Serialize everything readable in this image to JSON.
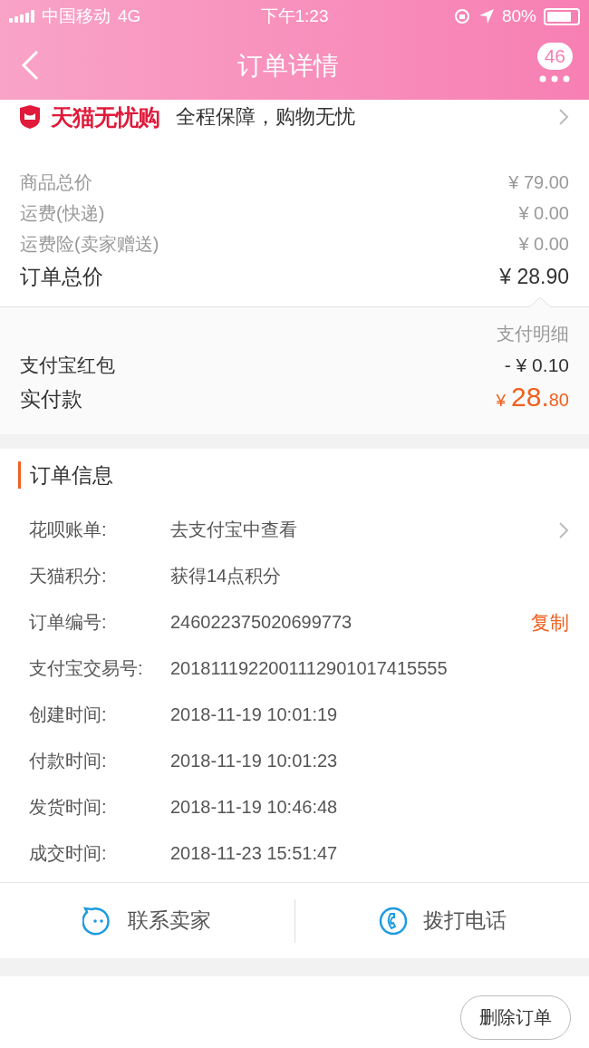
{
  "status_bar": {
    "carrier": "中国移动",
    "network": "4G",
    "time": "下午1:23",
    "battery": "80%"
  },
  "nav": {
    "title": "订单详情",
    "badge": "46"
  },
  "guarantee": {
    "brand": "天猫无忧购",
    "text": "全程保障，购物无忧"
  },
  "price_rows": [
    {
      "label": "商品总价",
      "value": "¥ 79.00"
    },
    {
      "label": "运费(快递)",
      "value": "¥ 0.00"
    },
    {
      "label": "运费险(卖家赠送)",
      "value": "¥ 0.00"
    }
  ],
  "total": {
    "label": "订单总价",
    "value": "¥ 28.90"
  },
  "payment": {
    "title": "支付明细",
    "rows": [
      {
        "label": "支付宝红包",
        "value": "- ¥ 0.10"
      }
    ],
    "paid": {
      "label": "实付款",
      "currency": "¥",
      "integer": "28.",
      "decimal": "80"
    }
  },
  "order_info": {
    "title": "订单信息",
    "rows": [
      {
        "kind": "link",
        "label": "花呗账单:",
        "value": "去支付宝中查看"
      },
      {
        "kind": "plain",
        "label": "天猫积分:",
        "value": "获得14点积分"
      },
      {
        "kind": "copy",
        "label": "订单编号:",
        "value": "246022375020699773",
        "action": "复制"
      },
      {
        "kind": "plain",
        "label": "支付宝交易号:",
        "value": "2018111922001112901017415555"
      },
      {
        "kind": "plain",
        "label": "创建时间:",
        "value": "2018-11-19 10:01:19"
      },
      {
        "kind": "plain",
        "label": "付款时间:",
        "value": "2018-11-19 10:01:23"
      },
      {
        "kind": "plain",
        "label": "发货时间:",
        "value": "2018-11-19 10:46:48"
      },
      {
        "kind": "plain",
        "label": "成交时间:",
        "value": "2018-11-23 15:51:47"
      }
    ]
  },
  "contact_actions": [
    {
      "kind": "chat",
      "label": "联系卖家"
    },
    {
      "kind": "phone",
      "label": "拨打电话"
    }
  ],
  "footer_buttons": [
    "删除订单"
  ]
}
